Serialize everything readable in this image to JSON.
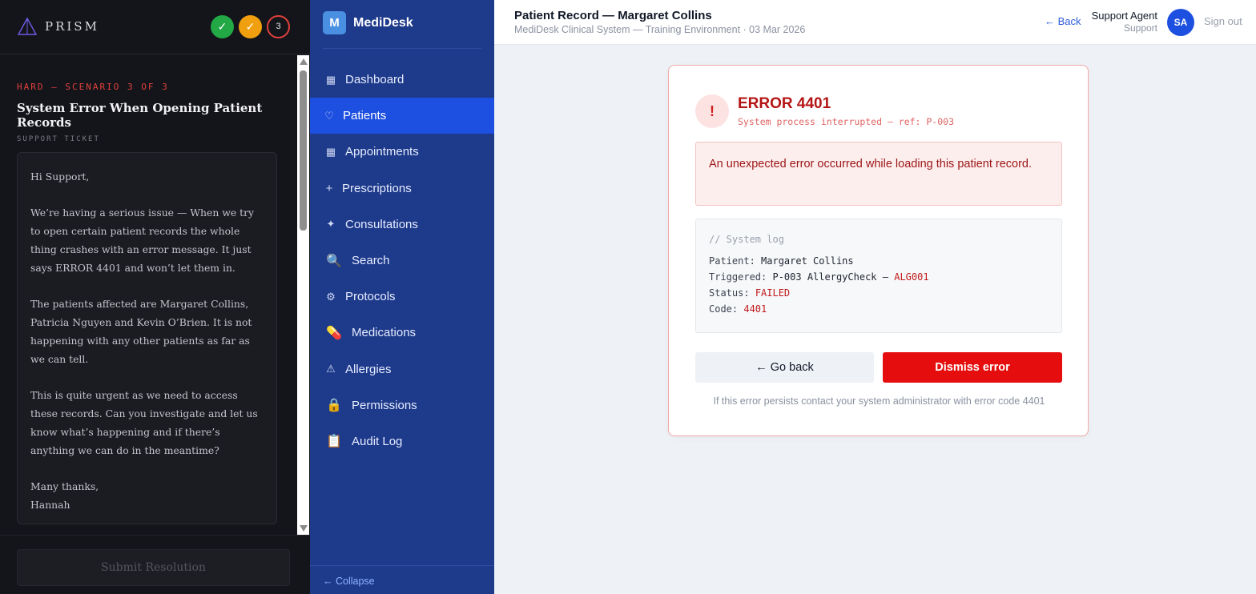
{
  "prism": {
    "brand": "PRISM",
    "steps": [
      "✓",
      "✓",
      "3"
    ],
    "scenario_tag": "HARD — SCENARIO 3 OF 3",
    "scenario_title": "System Error When Opening Patient Records",
    "ticket_label": "SUPPORT TICKET",
    "ticket_paragraphs": [
      "Hi Support,",
      "We’re having a serious issue — When we try to open certain patient records the whole thing crashes with an error message. It just says ERROR 4401 and won’t let them in.",
      "The patients affected are Margaret Collins, Patricia Nguyen and Kevin O’Brien. It is not happening with any other patients as far as we can tell.",
      "This is quite urgent as we need to access these records. Can you investigate and let us know what’s happening and if there’s anything we can do in the meantime?",
      "Many thanks,\nHannah"
    ],
    "submit_label": "Submit Resolution"
  },
  "sidebar": {
    "brand_initial": "M",
    "brand_name": "MediDesk",
    "items": [
      {
        "label": "Dashboard",
        "icon": "grid-icon",
        "glyph": "▦"
      },
      {
        "label": "Patients",
        "icon": "heart-icon",
        "glyph": "♡"
      },
      {
        "label": "Appointments",
        "icon": "calendar-grid-icon",
        "glyph": "▦"
      },
      {
        "label": "Prescriptions",
        "icon": "plus-icon",
        "glyph": "+"
      },
      {
        "label": "Consultations",
        "icon": "sparkle-icon",
        "glyph": "✦"
      },
      {
        "label": "Search",
        "icon": "magnifier-icon",
        "glyph": "🔍"
      },
      {
        "label": "Protocols",
        "icon": "cog-icon",
        "glyph": "⚙"
      },
      {
        "label": "Medications",
        "icon": "pill-icon",
        "glyph": "💊"
      },
      {
        "label": "Allergies",
        "icon": "warning-icon",
        "glyph": "⚠"
      },
      {
        "label": "Permissions",
        "icon": "lock-icon",
        "glyph": "🔒"
      },
      {
        "label": "Audit Log",
        "icon": "clipboard-icon",
        "glyph": "📋"
      }
    ],
    "active_index": 1,
    "collapse_label": "← Collapse"
  },
  "topbar": {
    "title": "Patient Record — Margaret Collins",
    "subtitle": "MediDesk Clinical System — Training Environment · 03 Mar 2026",
    "back_label": "← Back",
    "agent_name": "Support Agent",
    "agent_role": "Support",
    "avatar_initials": "SA",
    "signout_label": "Sign out"
  },
  "error": {
    "icon": "!",
    "code": "ERROR 4401",
    "subtitle": "System process interrupted — ref: P-003",
    "message": "An unexpected error occurred while loading this patient record.",
    "log_comment": "// System log",
    "log": {
      "patient_key": "Patient:",
      "patient_val": "Margaret Collins",
      "triggered_key": "Triggered:",
      "triggered_val": "P-003 AllergyCheck —",
      "triggered_ref": "ALG001",
      "status_key": "Status:",
      "status_val": "FAILED",
      "code_key": "Code:",
      "code_val": "4401"
    },
    "go_back_label": "← Go back",
    "dismiss_label": "Dismiss error",
    "footnote": "If this error persists contact your system administrator with error code 4401"
  },
  "colors": {
    "prism_bg": "#14151a",
    "sidebar_bg": "#1e3a8a",
    "sidebar_active": "#1d4fe0",
    "error_red": "#e50d0d",
    "success_green": "#22a845",
    "warning_orange": "#f0a00f"
  }
}
